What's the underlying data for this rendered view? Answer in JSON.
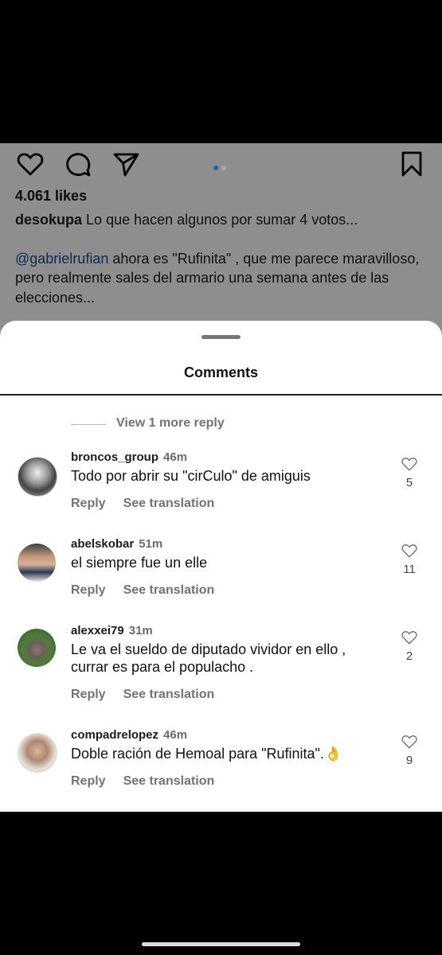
{
  "post": {
    "likes": "4.061 likes",
    "caption_user": "desokupa",
    "caption_line1": "Lo que hacen algunos por sumar 4 votos...",
    "mention": "@gabrielrufian",
    "caption_line2_rest": "ahora es \"Rufinita\" , que me parece maravilloso,",
    "caption_line3": "pero realmente sales del armario una semana antes de las",
    "caption_line4": "elecciones...",
    "carousel_active_color": "#1a5fb4"
  },
  "sheet": {
    "title": "Comments",
    "view_more": "View 1 more reply"
  },
  "comments": [
    {
      "user": "broncos_group",
      "time": "46m",
      "text": "Todo por abrir su \"cirCulo\" de amiguis",
      "reply": "Reply",
      "translate": "See translation",
      "likes": "5"
    },
    {
      "user": "abelskobar",
      "time": "51m",
      "text": "el siempre fue un elle",
      "reply": "Reply",
      "translate": "See translation",
      "likes": "11"
    },
    {
      "user": "alexxei79",
      "time": "31m",
      "text": "Le va el sueldo de diputado vividor en ello , currar es para el populacho .",
      "reply": "Reply",
      "translate": "See translation",
      "likes": "2"
    },
    {
      "user": "compadrelopez",
      "time": "46m",
      "text": "Doble ración de Hemoal para \"Rufinita\".👌",
      "reply": "Reply",
      "translate": "See translation",
      "likes": "9"
    }
  ],
  "icons": {
    "like": "heart-icon",
    "comment": "comment-icon",
    "share": "send-icon",
    "save": "bookmark-icon"
  }
}
